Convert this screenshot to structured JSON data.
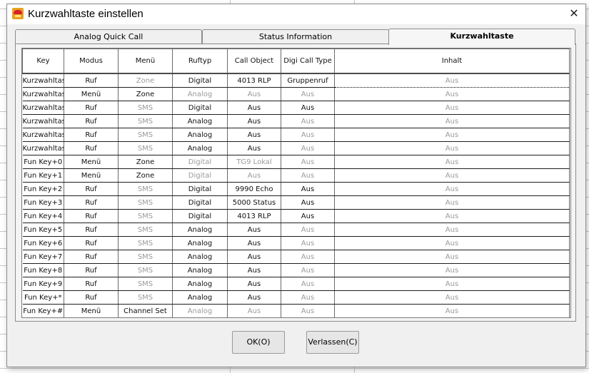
{
  "window": {
    "title": "Kurzwahltaste einstellen"
  },
  "tabs": [
    {
      "label": "Analog Quick Call"
    },
    {
      "label": "Status Information"
    },
    {
      "label": "Kurzwahltaste"
    }
  ],
  "table": {
    "columns": [
      "Key",
      "Modus",
      "Menü",
      "Ruftyp",
      "Call Object",
      "Digi Call Type",
      "Inhalt"
    ],
    "rows": [
      {
        "cells": [
          "Kurzwahltaste",
          "Ruf",
          "Zone",
          "Digital",
          "4013 RLP",
          "Gruppenruf",
          "Aus"
        ],
        "gray": [
          false,
          false,
          true,
          false,
          false,
          false,
          true
        ]
      },
      {
        "cells": [
          "Kurzwahltaste",
          "Menü",
          "Zone",
          "Analog",
          "Aus",
          "Aus",
          "Aus"
        ],
        "gray": [
          false,
          false,
          false,
          true,
          true,
          true,
          true
        ]
      },
      {
        "cells": [
          "Kurzwahltaste",
          "Ruf",
          "SMS",
          "Digital",
          "Aus",
          "Aus",
          "Aus"
        ],
        "gray": [
          false,
          false,
          true,
          false,
          false,
          false,
          true
        ]
      },
      {
        "cells": [
          "Kurzwahltaste",
          "Ruf",
          "SMS",
          "Analog",
          "Aus",
          "Aus",
          "Aus"
        ],
        "gray": [
          false,
          false,
          true,
          false,
          false,
          true,
          true
        ]
      },
      {
        "cells": [
          "Kurzwahltaste",
          "Ruf",
          "SMS",
          "Analog",
          "Aus",
          "Aus",
          "Aus"
        ],
        "gray": [
          false,
          false,
          true,
          false,
          false,
          true,
          true
        ]
      },
      {
        "cells": [
          "Kurzwahltaste",
          "Ruf",
          "SMS",
          "Analog",
          "Aus",
          "Aus",
          "Aus"
        ],
        "gray": [
          false,
          false,
          true,
          false,
          false,
          true,
          true
        ]
      },
      {
        "cells": [
          "Fun Key+0",
          "Menü",
          "Zone",
          "Digital",
          "TG9 Lokal",
          "Aus",
          "Aus"
        ],
        "gray": [
          false,
          false,
          false,
          true,
          true,
          true,
          true
        ]
      },
      {
        "cells": [
          "Fun Key+1",
          "Menü",
          "Zone",
          "Digital",
          "Aus",
          "Aus",
          "Aus"
        ],
        "gray": [
          false,
          false,
          false,
          true,
          true,
          true,
          true
        ]
      },
      {
        "cells": [
          "Fun Key+2",
          "Ruf",
          "SMS",
          "Digital",
          "9990 Echo",
          "Aus",
          "Aus"
        ],
        "gray": [
          false,
          false,
          true,
          false,
          false,
          false,
          true
        ]
      },
      {
        "cells": [
          "Fun Key+3",
          "Ruf",
          "SMS",
          "Digital",
          "5000 Status",
          "Aus",
          "Aus"
        ],
        "gray": [
          false,
          false,
          true,
          false,
          false,
          false,
          true
        ]
      },
      {
        "cells": [
          "Fun Key+4",
          "Ruf",
          "SMS",
          "Digital",
          "4013 RLP",
          "Aus",
          "Aus"
        ],
        "gray": [
          false,
          false,
          true,
          false,
          false,
          false,
          true
        ]
      },
      {
        "cells": [
          "Fun Key+5",
          "Ruf",
          "SMS",
          "Analog",
          "Aus",
          "Aus",
          "Aus"
        ],
        "gray": [
          false,
          false,
          true,
          false,
          false,
          true,
          true
        ]
      },
      {
        "cells": [
          "Fun Key+6",
          "Ruf",
          "SMS",
          "Analog",
          "Aus",
          "Aus",
          "Aus"
        ],
        "gray": [
          false,
          false,
          true,
          false,
          false,
          true,
          true
        ]
      },
      {
        "cells": [
          "Fun Key+7",
          "Ruf",
          "SMS",
          "Analog",
          "Aus",
          "Aus",
          "Aus"
        ],
        "gray": [
          false,
          false,
          true,
          false,
          false,
          true,
          true
        ]
      },
      {
        "cells": [
          "Fun Key+8",
          "Ruf",
          "SMS",
          "Analog",
          "Aus",
          "Aus",
          "Aus"
        ],
        "gray": [
          false,
          false,
          true,
          false,
          false,
          true,
          true
        ]
      },
      {
        "cells": [
          "Fun Key+9",
          "Ruf",
          "SMS",
          "Analog",
          "Aus",
          "Aus",
          "Aus"
        ],
        "gray": [
          false,
          false,
          true,
          false,
          false,
          true,
          true
        ]
      },
      {
        "cells": [
          "Fun Key+*",
          "Ruf",
          "SMS",
          "Analog",
          "Aus",
          "Aus",
          "Aus"
        ],
        "gray": [
          false,
          false,
          true,
          false,
          false,
          true,
          true
        ]
      },
      {
        "cells": [
          "Fun Key+#",
          "Menü",
          "Channel Set",
          "Analog",
          "Aus",
          "Aus",
          "Aus"
        ],
        "gray": [
          false,
          false,
          false,
          true,
          true,
          true,
          true
        ]
      }
    ]
  },
  "buttons": {
    "ok": "OK(O)",
    "exit": "Verlassen(C)"
  },
  "colors": {
    "gray_text": "#9a9a9a",
    "icon_orange": "#e8a020",
    "icon_red": "#d8202a"
  }
}
